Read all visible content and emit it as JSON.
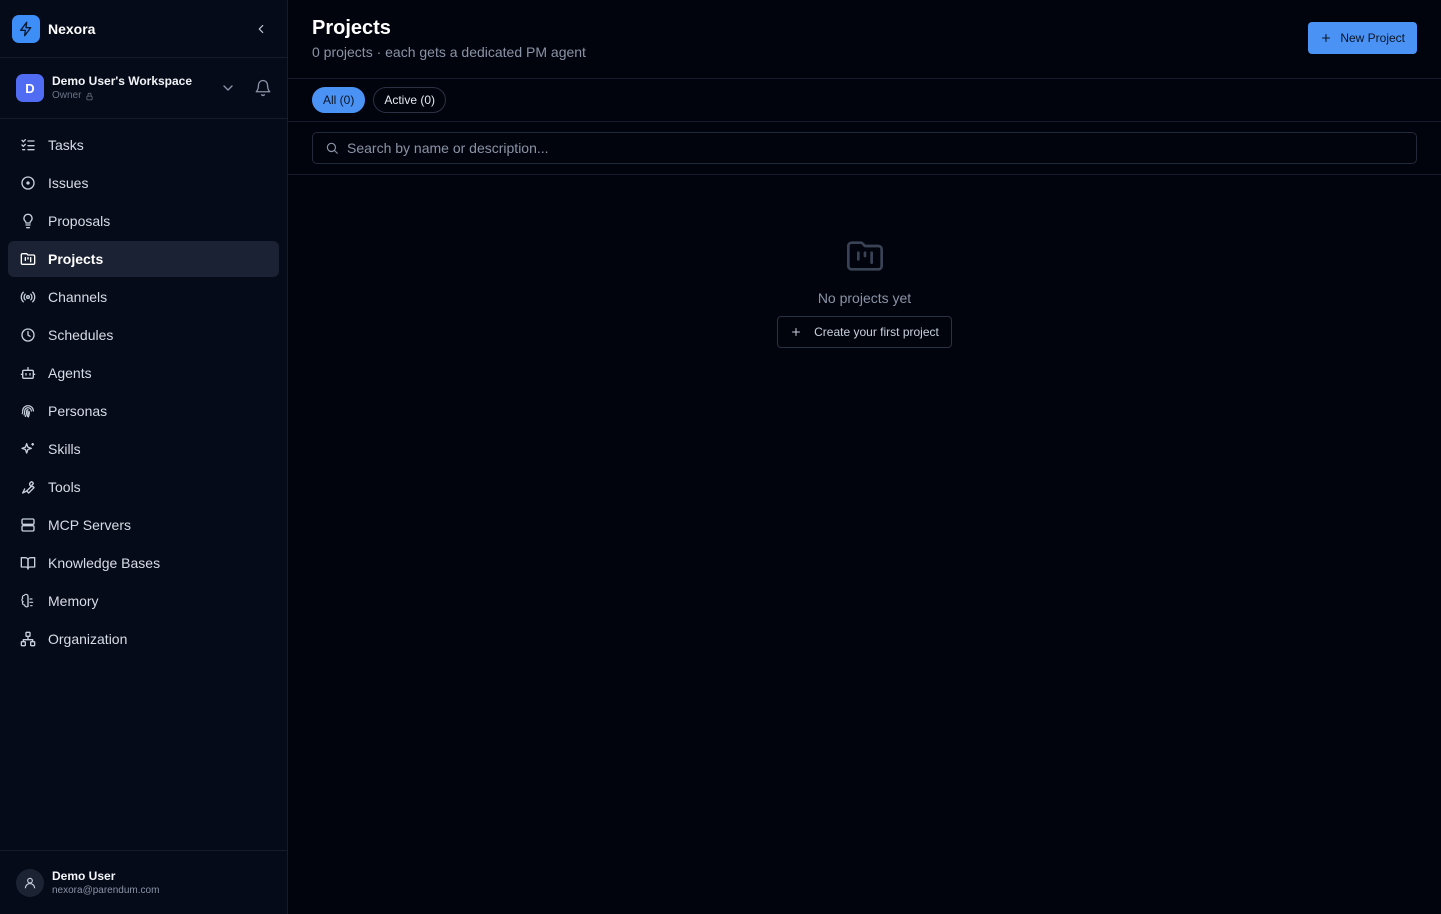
{
  "app": {
    "name": "Nexora",
    "accent_color": "#4a93f5"
  },
  "workspace": {
    "avatar_letter": "D",
    "name": "Demo User's Workspace",
    "role": "Owner"
  },
  "sidebar": {
    "items": [
      {
        "label": "Tasks",
        "icon": "tasks-icon"
      },
      {
        "label": "Issues",
        "icon": "issues-icon"
      },
      {
        "label": "Proposals",
        "icon": "lightbulb-icon"
      },
      {
        "label": "Projects",
        "icon": "folder-kanban-icon",
        "active": true
      },
      {
        "label": "Channels",
        "icon": "radio-icon"
      },
      {
        "label": "Schedules",
        "icon": "clock-icon"
      },
      {
        "label": "Agents",
        "icon": "bot-icon"
      },
      {
        "label": "Personas",
        "icon": "fingerprint-icon"
      },
      {
        "label": "Skills",
        "icon": "sparkles-icon"
      },
      {
        "label": "Tools",
        "icon": "wrench-icon"
      },
      {
        "label": "MCP Servers",
        "icon": "server-icon"
      },
      {
        "label": "Knowledge Bases",
        "icon": "book-icon"
      },
      {
        "label": "Memory",
        "icon": "brain-icon"
      },
      {
        "label": "Organization",
        "icon": "org-chart-icon"
      }
    ]
  },
  "user": {
    "name": "Demo User",
    "email": "nexora@parendum.com"
  },
  "header": {
    "title": "Projects",
    "subtitle": "0 projects · each gets a dedicated PM agent",
    "new_button_label": "New Project"
  },
  "tabs": [
    {
      "label": "All (0)",
      "active": true
    },
    {
      "label": "Active (0)",
      "active": false
    }
  ],
  "search": {
    "placeholder": "Search by name or description...",
    "value": ""
  },
  "empty_state": {
    "text": "No projects yet",
    "button_label": "Create your first project"
  }
}
